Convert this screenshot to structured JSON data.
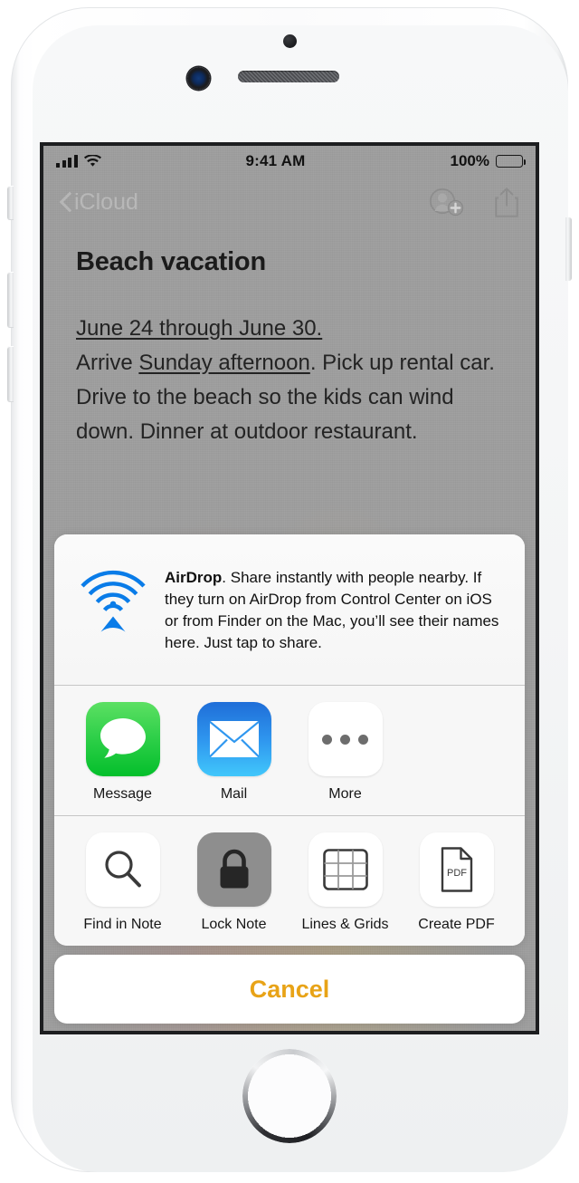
{
  "device": {
    "name": "iphone-white",
    "hardware": {
      "sensor": "proximity-sensor",
      "camera": "front-camera",
      "speaker": "earpiece-speaker",
      "home": "home-button"
    }
  },
  "status_bar": {
    "signal_icon": "cellular-bars-icon",
    "wifi_icon": "wifi-icon",
    "time": "9:41 AM",
    "battery_percent": "100%",
    "battery_icon": "battery-full-icon"
  },
  "nav_bar": {
    "back_label": "iCloud",
    "back_icon": "chevron-left-icon",
    "add_person_icon": "add-person-icon",
    "share_icon": "share-icon"
  },
  "note": {
    "title": "Beach vacation",
    "line1": "June 24 through June 30.",
    "line2_underlined": "Sunday afternoon",
    "line2_prefix": "Arrive ",
    "line2_suffix": ". Pick up rental car. Drive to the beach so the kids can wind down. Dinner at outdoor restaurant."
  },
  "share_sheet": {
    "airdrop": {
      "icon": "airdrop-icon",
      "title": "AirDrop",
      "description": ". Share instantly with people nearby. If they turn on AirDrop from Control Center on iOS or from Finder on the Mac, you’ll see their names here. Just tap to share."
    },
    "apps": [
      {
        "label": "Message",
        "icon": "message-bubble-icon"
      },
      {
        "label": "Mail",
        "icon": "mail-envelope-icon"
      },
      {
        "label": "More",
        "icon": "more-dots-icon"
      }
    ],
    "actions": [
      {
        "label": "Find in Note",
        "icon": "magnifier-icon",
        "state": "normal"
      },
      {
        "label": "Lock Note",
        "icon": "lock-icon",
        "state": "pressed"
      },
      {
        "label": "Lines & Grids",
        "icon": "grid-icon",
        "state": "normal"
      },
      {
        "label": "Create PDF",
        "icon": "pdf-document-icon",
        "state": "normal"
      },
      {
        "label": "",
        "icon": "clipped-action-icon",
        "state": "normal"
      }
    ],
    "cancel_label": "Cancel"
  },
  "colors": {
    "airdrop_blue": "#0a7ce8",
    "cancel_amber": "#e8a317",
    "message_green": "#30d04a",
    "mail_blue": "#2f97ef",
    "pressed_gray": "#8e8e8e",
    "dim_overlay": "#9d9d9d"
  }
}
